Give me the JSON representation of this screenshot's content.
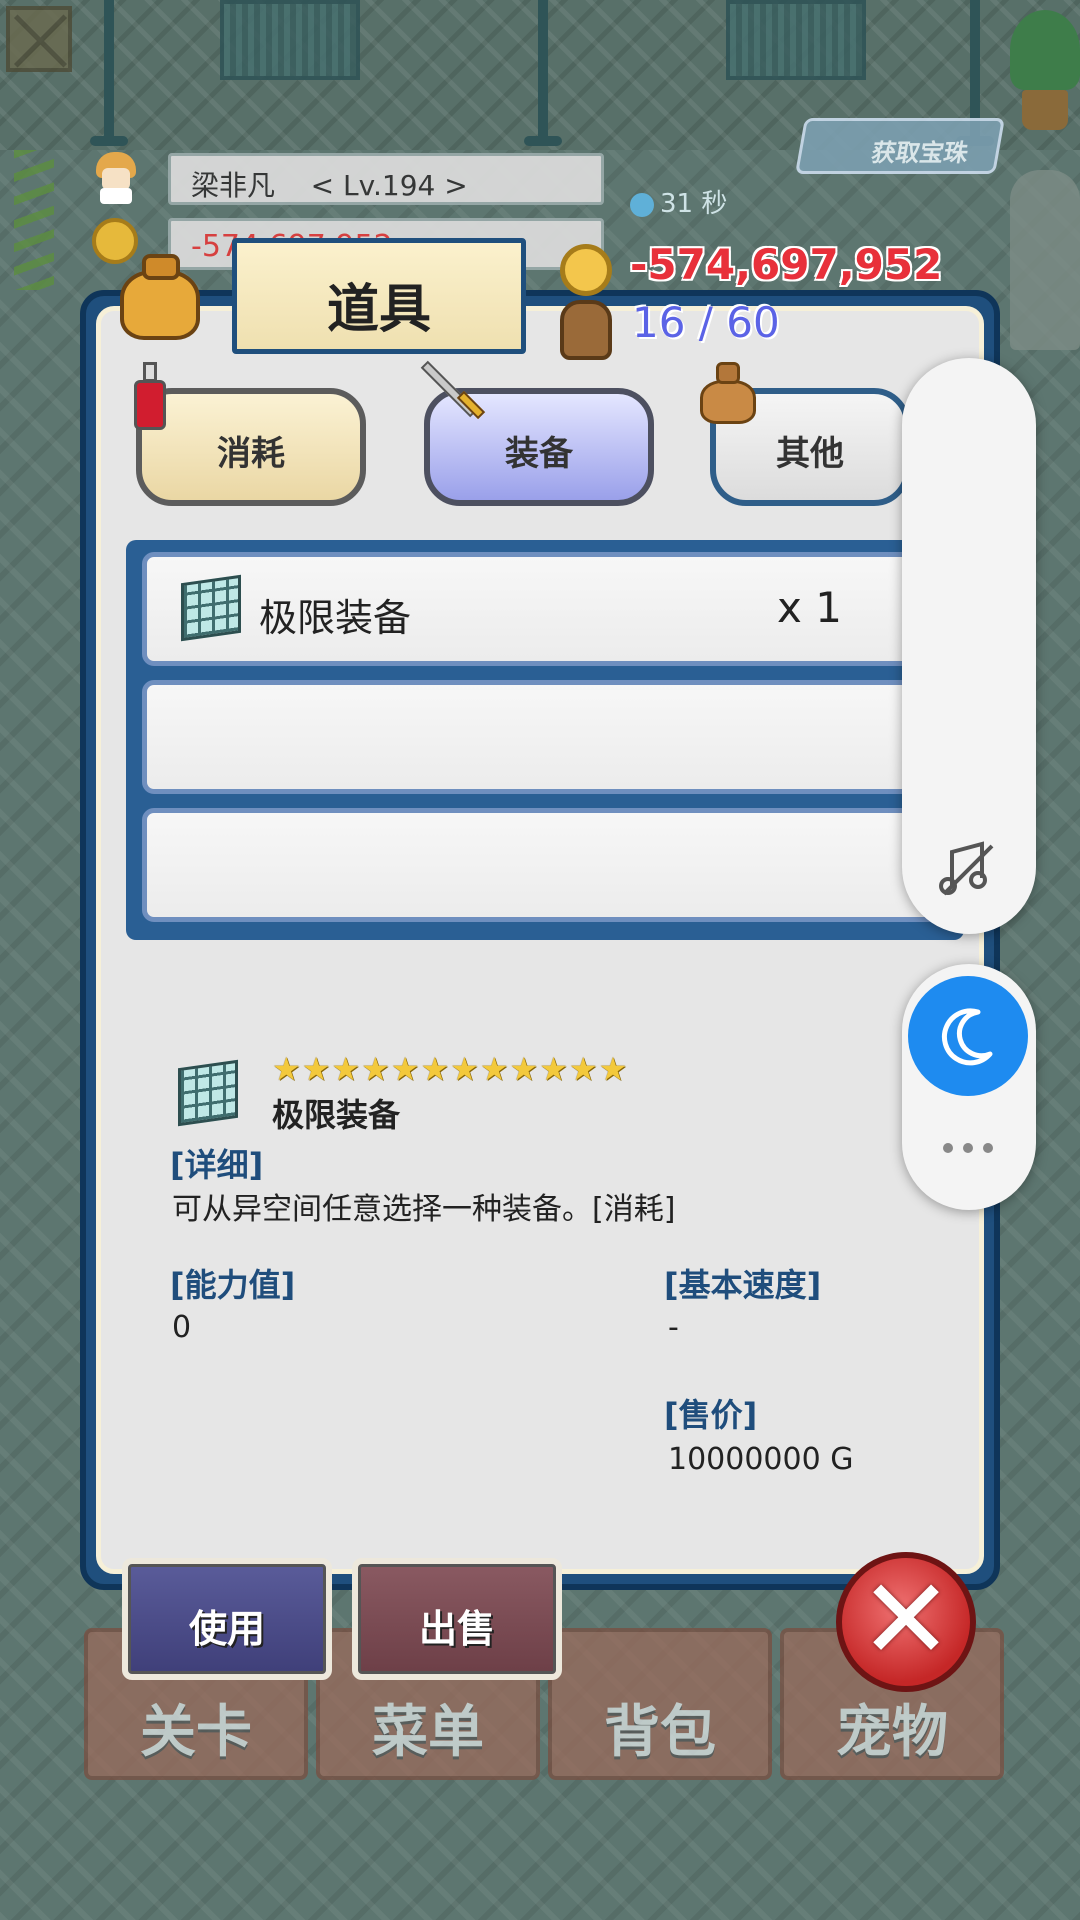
{
  "hud": {
    "player_name": "梁非凡",
    "player_level": "< Lv.194 >",
    "money_behind": "-574,697,952",
    "timer": "31 秒",
    "gem_label": "获取宝珠"
  },
  "panel": {
    "title": "道具",
    "money": "-574,697,952",
    "capacity": "16 / 60"
  },
  "tabs": [
    {
      "label": "消耗"
    },
    {
      "label": "装备"
    },
    {
      "label": "其他"
    }
  ],
  "active_tab": "装备",
  "items": [
    {
      "name": "极限装备",
      "count": "x 1"
    }
  ],
  "detail": {
    "name": "极限装备",
    "stars": "★★★★★★★★★★★★",
    "star_count": 12,
    "detail_label": "[详细]",
    "description": "可从异空间任意选择一种装备。[消耗]",
    "ability_label": "[能力值]",
    "ability_value": "0",
    "speed_label": "[基本速度]",
    "speed_value": "-",
    "price_label": "[售价]",
    "price_value": "10000000 G"
  },
  "actions": {
    "use": "使用",
    "sell": "出售",
    "close_glyph": "✕"
  },
  "bottom_nav": [
    {
      "label": "关卡"
    },
    {
      "label": "菜单"
    },
    {
      "label": "背包"
    },
    {
      "label": "宠物"
    }
  ],
  "icons": {
    "bag": "bag-icon",
    "coin": "coin-icon",
    "backpack": "backpack-icon",
    "potion": "potion-icon",
    "sword": "sword-icon",
    "sack": "sack-icon",
    "item": "cube-icon",
    "mute": "music-off-icon",
    "moon": "moon-icon",
    "more": "more-icon"
  },
  "colors": {
    "money": "#e8303a",
    "capacity": "#5b63e6",
    "panel_frame": "#1f4f7d",
    "moon_button": "#1e8bf0"
  }
}
